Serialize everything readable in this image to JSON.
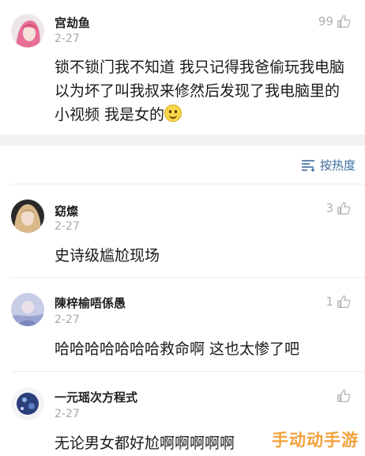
{
  "comments": [
    {
      "name": "宫劫鱼",
      "date": "2-27",
      "likes": "99",
      "text": "锁不锁门我不知道 我只记得我爸偷玩我电脑以为坏了叫我叔来修然后发现了我电脑里的小视频 我是女的",
      "emoji": "slightly-smiling-face"
    },
    {
      "name": "窈燦",
      "date": "2-27",
      "likes": "3",
      "text": "史诗级尴尬现场"
    },
    {
      "name": "陳梓榆唔係愚",
      "date": "2-27",
      "likes": "1",
      "text": "哈哈哈哈哈哈哈救命啊 这也太惨了吧"
    },
    {
      "name": "一元瑶次方程式",
      "date": "2-27",
      "likes": "",
      "text": "无论男女都好尬啊啊啊啊啊"
    }
  ],
  "sort": {
    "label": "按热度",
    "icon": "sort-lines-icon"
  },
  "watermark": "手动动手游",
  "colors": {
    "accent": "#3c6b9e",
    "muted": "#a8a8a8",
    "watermark": "#f3a23b"
  }
}
